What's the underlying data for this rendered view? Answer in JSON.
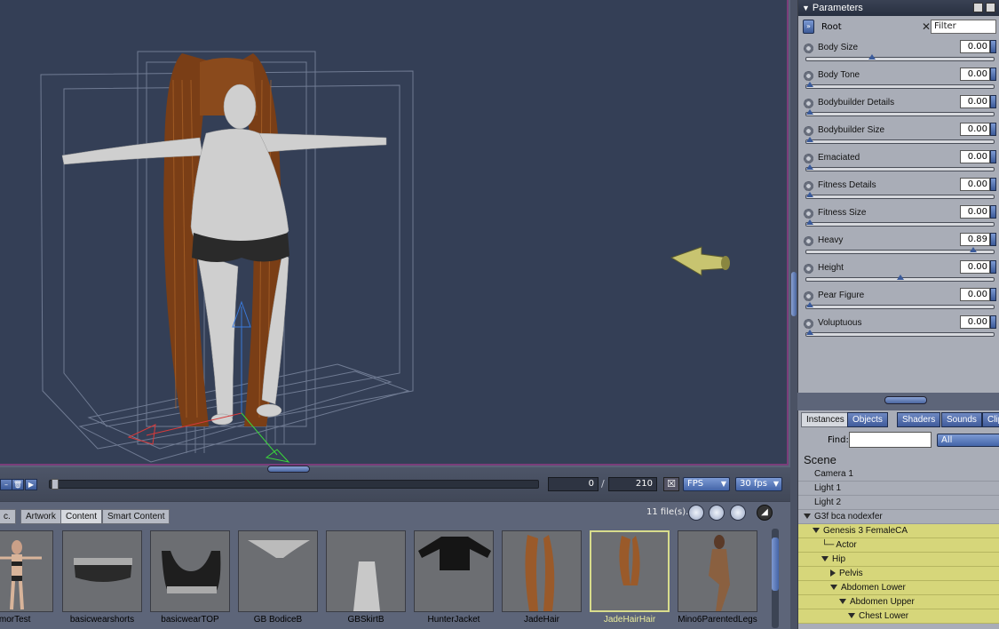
{
  "parameters_panel": {
    "title": "Parameters",
    "root_label": "Root",
    "filter_placeholder": "Filter",
    "items": [
      {
        "name": "Body Size",
        "value": "0.00",
        "slider": 0.35
      },
      {
        "name": "Body Tone",
        "value": "0.00",
        "slider": 0.02
      },
      {
        "name": "Bodybuilder Details",
        "value": "0.00",
        "slider": 0.02
      },
      {
        "name": "Bodybuilder Size",
        "value": "0.00",
        "slider": 0.02
      },
      {
        "name": "Emaciated",
        "value": "0.00",
        "slider": 0.02
      },
      {
        "name": "Fitness Details",
        "value": "0.00",
        "slider": 0.02
      },
      {
        "name": "Fitness Size",
        "value": "0.00",
        "slider": 0.02
      },
      {
        "name": "Heavy",
        "value": "0.89",
        "slider": 0.89
      },
      {
        "name": "Height",
        "value": "0.00",
        "slider": 0.5
      },
      {
        "name": "Pear Figure",
        "value": "0.00",
        "slider": 0.02
      },
      {
        "name": "Voluptuous",
        "value": "0.00",
        "slider": 0.02
      }
    ]
  },
  "timeline": {
    "current_frame": "0",
    "slash": "/",
    "total_frames": "210",
    "fps_mode": "FPS",
    "fps_rate": "30 fps"
  },
  "library": {
    "tabs": [
      "c.",
      "Artwork",
      "Content",
      "Smart Content"
    ],
    "active_tab": "Content",
    "file_count": "11 file(s).",
    "items": [
      {
        "label": "rmorTest"
      },
      {
        "label": "basicwearshorts"
      },
      {
        "label": "basicwearTOP"
      },
      {
        "label": "GB BodiceB"
      },
      {
        "label": "GBSkirtB"
      },
      {
        "label": "HunterJacket"
      },
      {
        "label": "JadeHair"
      },
      {
        "label": "JadeHairHair",
        "selected": true
      },
      {
        "label": "Mino6ParentedLegs"
      }
    ]
  },
  "scene_panel": {
    "tabs": [
      "Instances",
      "Objects",
      "Shaders",
      "Sounds",
      "Clips"
    ],
    "active_tab": "Instances",
    "find_label": "Find:",
    "find_select": "All",
    "title": "Scene",
    "tree": [
      {
        "label": "Camera 1",
        "depth": 0,
        "expander": "none",
        "highlight": false
      },
      {
        "label": "Light 1",
        "depth": 0,
        "expander": "none",
        "highlight": false
      },
      {
        "label": "Light 2",
        "depth": 0,
        "expander": "none",
        "highlight": false
      },
      {
        "label": "G3f bca nodexfer",
        "depth": 0,
        "expander": "open",
        "highlight": false
      },
      {
        "label": "Genesis 3 FemaleCA",
        "depth": 1,
        "expander": "open",
        "highlight": true
      },
      {
        "label": "Actor",
        "depth": 2,
        "expander": "none",
        "highlight": true
      },
      {
        "label": "Hip",
        "depth": 2,
        "expander": "open",
        "highlight": true
      },
      {
        "label": "Pelvis",
        "depth": 3,
        "expander": "closed",
        "highlight": true
      },
      {
        "label": "Abdomen Lower",
        "depth": 3,
        "expander": "open",
        "highlight": true
      },
      {
        "label": "Abdomen Upper",
        "depth": 4,
        "expander": "open",
        "highlight": true
      },
      {
        "label": "Chest Lower",
        "depth": 5,
        "expander": "open",
        "highlight": true
      }
    ]
  },
  "colors": {
    "viewport_bg": "#343f56",
    "panel_bg": "#a9adb7",
    "highlight_row": "#d6d67a",
    "accent_blue": "#4465a8"
  }
}
